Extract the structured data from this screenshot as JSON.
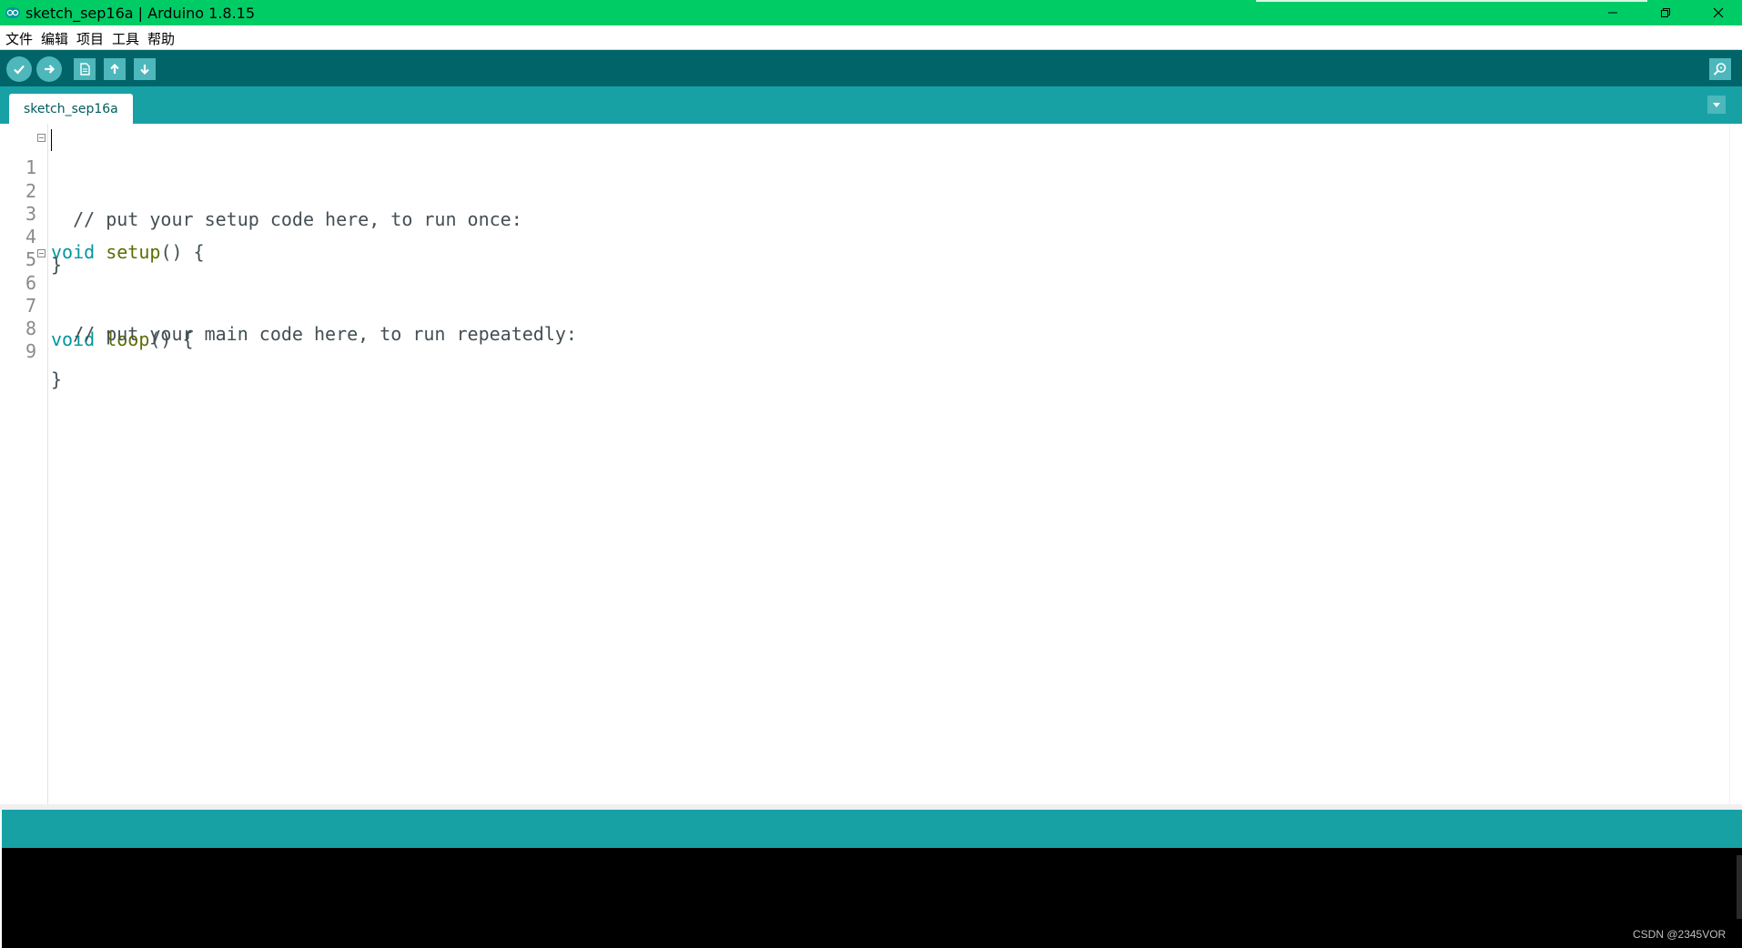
{
  "window": {
    "title": "sketch_sep16a | Arduino 1.8.15",
    "controls": [
      "minimize-icon",
      "restore-icon",
      "close-icon"
    ]
  },
  "menubar": {
    "items": [
      {
        "label": "文件"
      },
      {
        "label": "编辑"
      },
      {
        "label": "项目"
      },
      {
        "label": "工具"
      },
      {
        "label": "帮助"
      }
    ]
  },
  "toolbar": {
    "buttons": [
      {
        "name": "verify",
        "icon": "checkmark-icon"
      },
      {
        "name": "upload",
        "icon": "arrow-right-icon"
      },
      {
        "name": "new",
        "icon": "new-file-icon"
      },
      {
        "name": "open",
        "icon": "arrow-up-icon"
      },
      {
        "name": "save",
        "icon": "arrow-down-icon"
      }
    ],
    "right_button": {
      "name": "serial-monitor",
      "icon": "magnifier-icon"
    }
  },
  "tabs": [
    {
      "label": "sketch_sep16a",
      "active": true
    }
  ],
  "editor": {
    "lines": [
      {
        "num": "1",
        "fold": true
      },
      {
        "num": "2",
        "fold": false
      },
      {
        "num": "3",
        "fold": false
      },
      {
        "num": "4",
        "fold": false
      },
      {
        "num": "5",
        "fold": false
      },
      {
        "num": "6",
        "fold": true
      },
      {
        "num": "7",
        "fold": false
      },
      {
        "num": "8",
        "fold": false
      },
      {
        "num": "9",
        "fold": false
      }
    ],
    "code": {
      "l1_kw": "void",
      "l1_fn": "setup",
      "l1_rest": "() {",
      "l2": "  // put your setup code here, to run once:",
      "l4": "}",
      "l6_kw": "void",
      "l6_fn": "loop",
      "l6_rest": "() {",
      "l7": "  // put your main code here, to run repeatedly:",
      "l9": "}"
    }
  },
  "watermark": "CSDN @2345VOR",
  "colors": {
    "titlebar": "#00cc66",
    "toolbar": "#006468",
    "tabbar": "#17a1a5",
    "keyword": "#00979c",
    "function": "#5e6d03",
    "console": "#000000"
  }
}
